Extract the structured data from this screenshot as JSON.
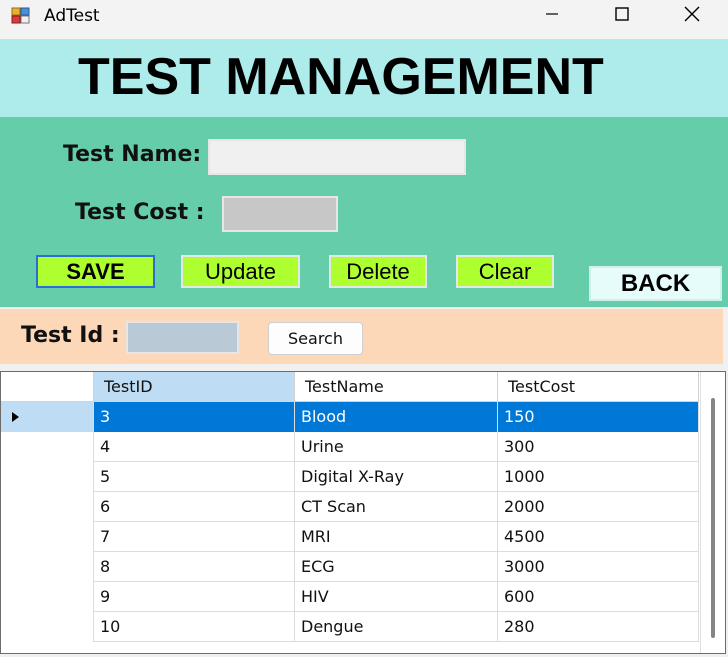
{
  "window": {
    "title": "AdTest"
  },
  "header": {
    "title": "TEST MANAGEMENT"
  },
  "form": {
    "test_name_label": "Test Name:",
    "test_name_value": "",
    "test_cost_label": "Test Cost :",
    "test_cost_value": ""
  },
  "buttons": {
    "save": "SAVE",
    "update": "Update",
    "delete": "Delete",
    "clear": "Clear",
    "back": "BACK"
  },
  "search": {
    "label": "Test Id :",
    "value": "",
    "button": "Search"
  },
  "grid": {
    "columns": [
      "TestID",
      "TestName",
      "TestCost"
    ],
    "rows": [
      {
        "id": "3",
        "name": "Blood",
        "cost": "150"
      },
      {
        "id": "4",
        "name": "Urine",
        "cost": "300"
      },
      {
        "id": "5",
        "name": "Digital X-Ray",
        "cost": "1000"
      },
      {
        "id": "6",
        "name": "CT Scan",
        "cost": "2000"
      },
      {
        "id": "7",
        "name": "MRI",
        "cost": "4500"
      },
      {
        "id": "8",
        "name": "ECG",
        "cost": "3000"
      },
      {
        "id": "9",
        "name": "HIV",
        "cost": "600"
      },
      {
        "id": "10",
        "name": "Dengue",
        "cost": "280"
      }
    ],
    "selected_row": 0
  },
  "colors": {
    "header_bg": "#aeebeb",
    "form_bg": "#66cdaa",
    "button_green": "#adff2f",
    "search_bg": "#fdd8b8",
    "selection": "#0078d7"
  },
  "icons": {
    "app": "app-icon",
    "minimize": "minimize-icon",
    "maximize": "maximize-icon",
    "close": "close-icon",
    "row_pointer": "row-pointer-icon"
  }
}
